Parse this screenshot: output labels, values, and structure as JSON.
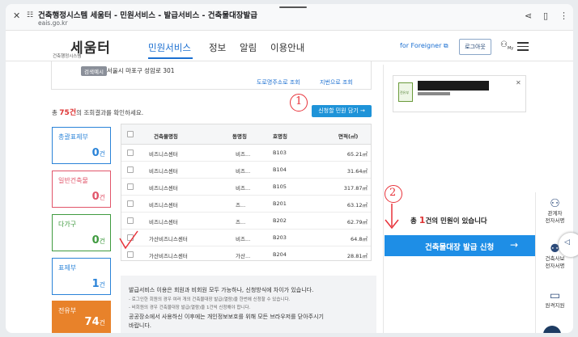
{
  "browser": {
    "title": "건축행정시스템 세움터 - 민원서비스 - 발급서비스 - 건축물대장발급",
    "url": "eais.go.kr"
  },
  "header": {
    "logo_text": "세움터",
    "logo_sub": "건축행정시스템",
    "nav": [
      "민원서비스",
      "정보",
      "알림",
      "이용안내"
    ],
    "foreigner": "for Foreigner",
    "logout": "로그아웃",
    "my": "My"
  },
  "address": {
    "badge": "검색예시",
    "text": "서울시 마포구 성암로 301",
    "links": [
      "도로명주소로 조회",
      "지번으로 조회"
    ]
  },
  "results": {
    "prefix": "총",
    "count": "75건",
    "suffix": "의 조회결과를 확인하세요.",
    "apply_button": "신청할 민원 담기 →"
  },
  "cards": [
    {
      "label": "총괄표제부",
      "value": "0",
      "unit": "건",
      "color": "#2a83d8"
    },
    {
      "label": "일반건축물",
      "value": "0",
      "unit": "건",
      "color": "#e1556a"
    },
    {
      "label": "다가구",
      "value": "0",
      "unit": "건",
      "color": "#3f9a3f"
    },
    {
      "label": "표제부",
      "value": "1",
      "unit": "건",
      "color": "#2a83d8"
    },
    {
      "label": "전유부",
      "value": "74",
      "unit": "건",
      "color": "#e8822a"
    }
  ],
  "table": {
    "headers": [
      "건축물명칭",
      "동명칭",
      "호명칭",
      "면적(㎡)"
    ],
    "rows": [
      {
        "name": "비즈니스센터",
        "dong": "비즈...",
        "ho": "B103",
        "area": "65.21㎡"
      },
      {
        "name": "비즈니스센터",
        "dong": "비즈...",
        "ho": "B104",
        "area": "31.64㎡"
      },
      {
        "name": "비즈니스센터",
        "dong": "비즈...",
        "ho": "B105",
        "area": "317.87㎡"
      },
      {
        "name": "비즈니스센터",
        "dong": "즈...",
        "ho": "B201",
        "area": "63.12㎡"
      },
      {
        "name": "비즈니스센터",
        "dong": "즈...",
        "ho": "B202",
        "area": "62.79㎡"
      },
      {
        "name": "가산비즈니스센터",
        "dong": "비즈...",
        "ho": "B203",
        "area": "64.8㎡"
      },
      {
        "name": "가산비즈니스센터",
        "dong": "가산...",
        "ho": "B204",
        "area": "28.81㎡"
      }
    ]
  },
  "notice": {
    "line1": "발급서비스 이용은 회원과 비회원 모두 가능하나, 신청방식에 차이가 있습니다.",
    "line2": "- 로그인한 회원의 경우 여러 개의 건축물대장 발급(열람)을 한번에 신청할 수 있습니다.",
    "line3": "- 비회원의 경우 건축물대장 발급(열람)을 1건씩 신청해야 합니다.",
    "line4": "공공장소에서 사용하신 이후에는 개인정보보호를 위해 모든 브라우저를 닫아주시기",
    "line5": "바랍니다."
  },
  "right": {
    "file_tag": "전유부",
    "pending_prefix": "총",
    "pending_count": "1",
    "pending_suffix": "건의 민원이 있습니다",
    "issue_button": "건축물대장 발급 신청",
    "issue_arrow": "→"
  },
  "side": [
    {
      "line1": "관계자",
      "line2": "전자서명"
    },
    {
      "line1": "건축사보",
      "line2": "전자서명"
    },
    {
      "line1": "원격지원",
      "line2": ""
    }
  ],
  "annotations": {
    "one": "1",
    "two": "2"
  }
}
